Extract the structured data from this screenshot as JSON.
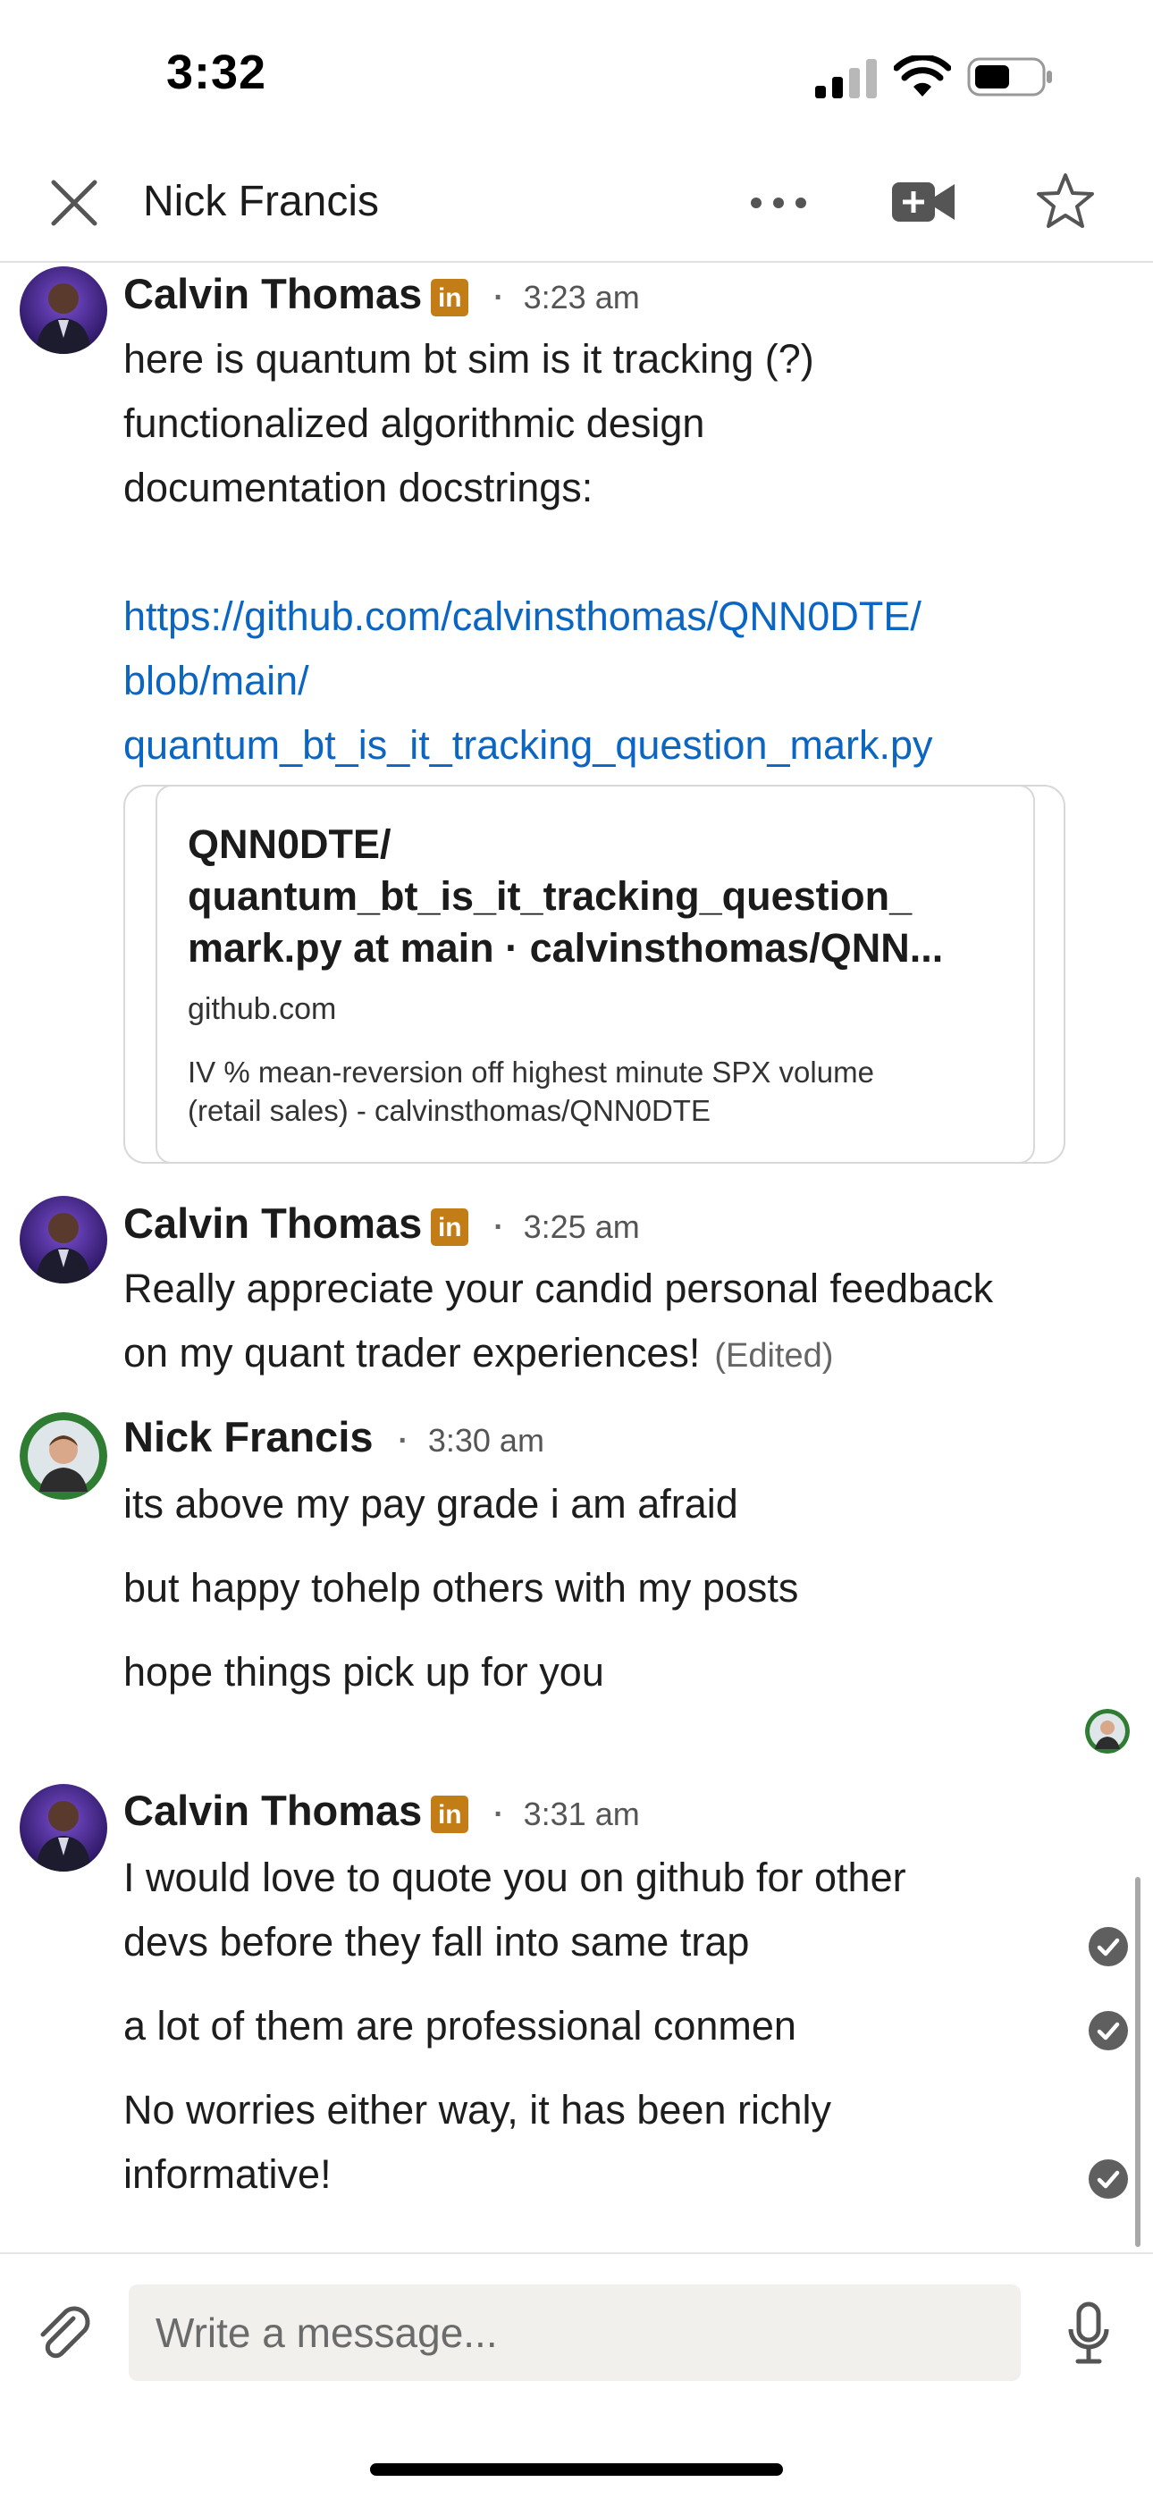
{
  "status_bar": {
    "time": "3:32",
    "icons": [
      "cellular-signal-icon",
      "wifi-icon",
      "battery-icon"
    ]
  },
  "header": {
    "title": "Nick Francis",
    "icons": [
      "close-icon",
      "more-icon",
      "video-call-icon",
      "star-icon"
    ]
  },
  "colors": {
    "link": "#0a66c2",
    "linkedin_badge": "#c37d16",
    "text": "#1d1d1d"
  },
  "messages": [
    {
      "sender": "Calvin Thomas",
      "badge": "in",
      "separator": "·",
      "time": "3:23 am",
      "lines": [
        "here is quantum bt sim is it tracking (?)",
        "functionalized algorithmic design",
        "documentation docstrings:"
      ],
      "link_lines": [
        "https://github.com/calvinsthomas/QNN0DTE/",
        "blob/main/",
        "quantum_bt_is_it_tracking_question_mark.py"
      ],
      "preview": {
        "title_lines": [
          "QNN0DTE/",
          "quantum_bt_is_it_tracking_question_",
          "mark.py at main · calvinsthomas/QNN..."
        ],
        "domain": "github.com",
        "description_lines": [
          "IV % mean-reversion off highest minute SPX volume",
          "(retail sales) - calvinsthomas/QNN0DTE"
        ]
      }
    },
    {
      "sender": "Calvin Thomas",
      "badge": "in",
      "separator": "·",
      "time": "3:25 am",
      "lines": [
        "Really appreciate your candid personal feedback",
        "on my quant trader experiences!"
      ],
      "edited": "(Edited)"
    },
    {
      "sender": "Nick Francis",
      "separator": "·",
      "time": "3:30 am",
      "lines": [
        "its above my pay grade i am afraid",
        "but happy tohelp others with my posts",
        "hope things pick up for you"
      ]
    },
    {
      "sender": "Calvin Thomas",
      "badge": "in",
      "separator": "·",
      "time": "3:31 am",
      "lines": [
        "I would love to quote you on github for other",
        "devs before they fall into same trap",
        "a lot of them are professional conmen",
        "No worries either way, it has been richly",
        "informative!"
      ]
    }
  ],
  "composer": {
    "placeholder": "Write a message...",
    "icons": [
      "attach-icon",
      "microphone-icon"
    ]
  }
}
